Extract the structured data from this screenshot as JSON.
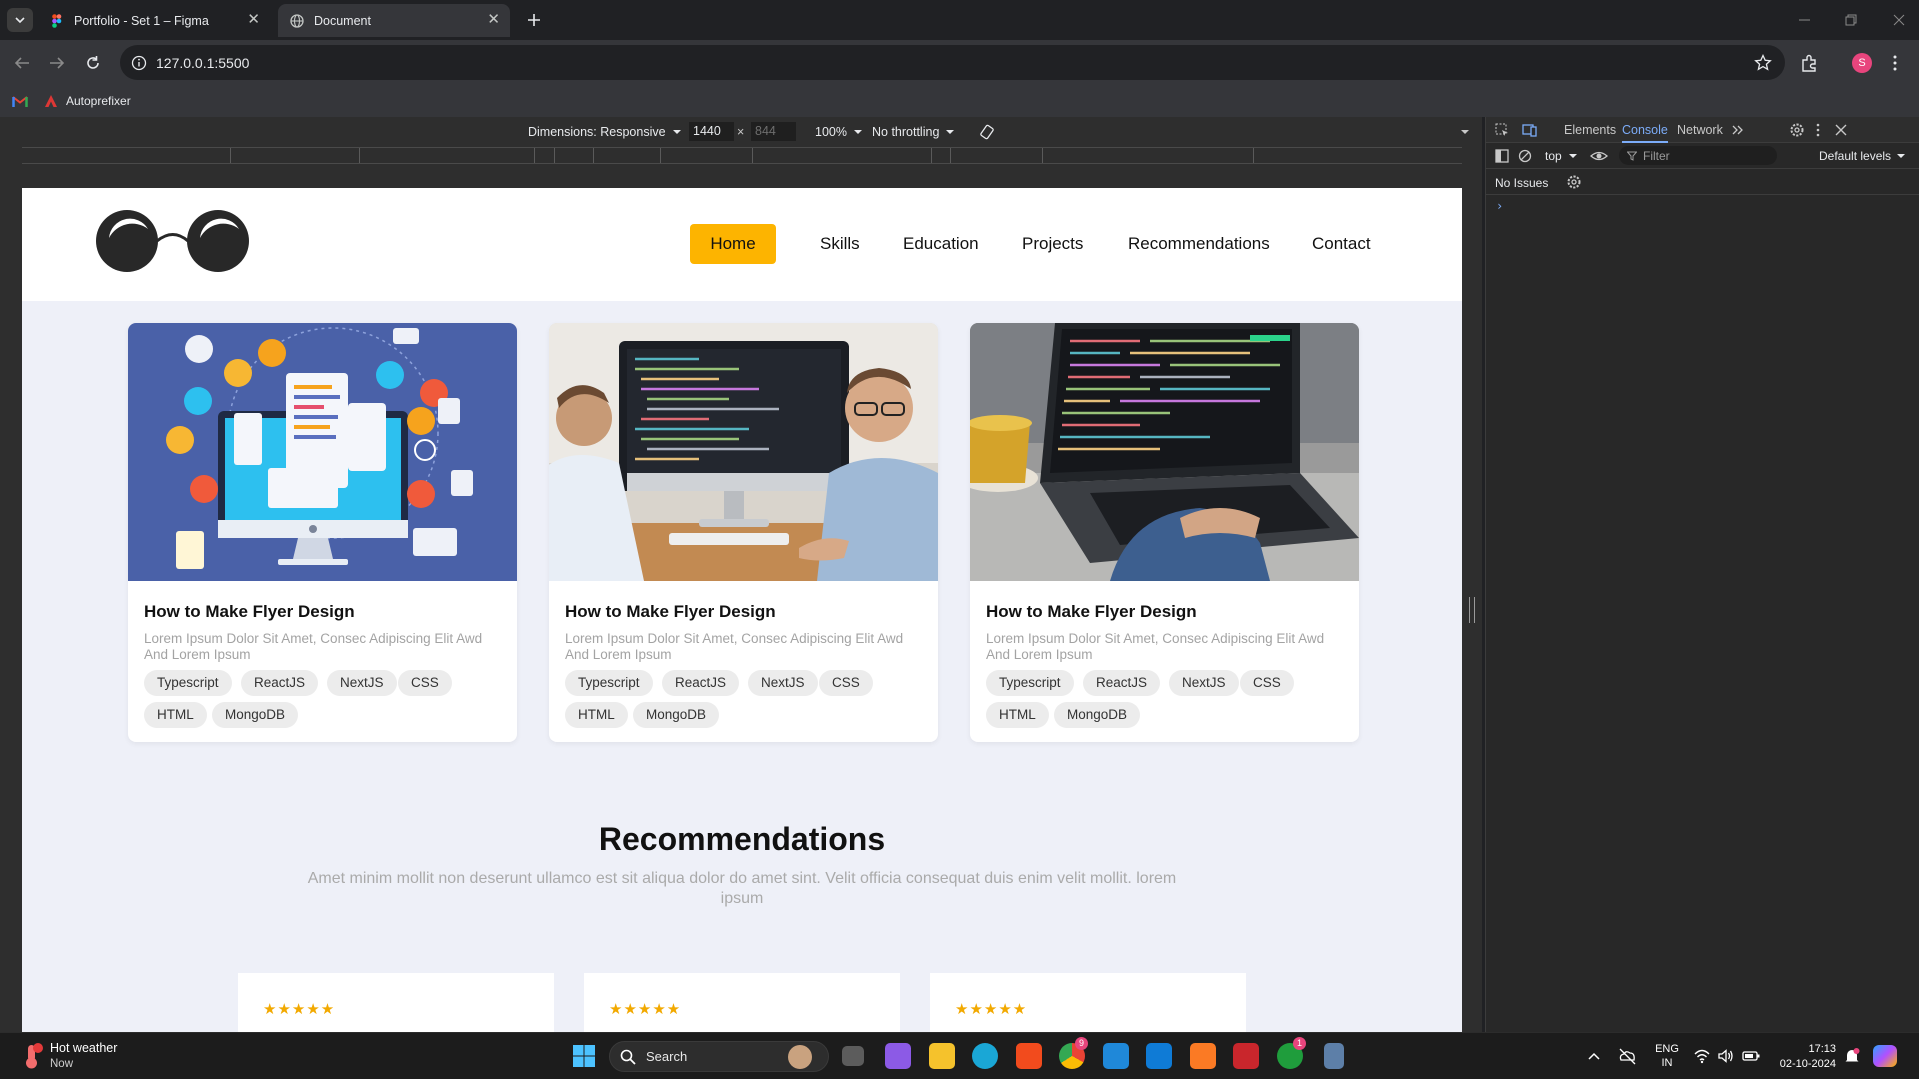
{
  "browser": {
    "tabs": [
      {
        "title": "Portfolio - Set 1 – Figma",
        "active": false
      },
      {
        "title": "Document",
        "active": true
      }
    ],
    "new_tab_icon": "plus-icon",
    "url": "127.0.0.1:5500",
    "profile_initial": "S",
    "bookmarks": [
      {
        "label": "",
        "icon": "gmail-icon"
      },
      {
        "label": "Autoprefixer",
        "icon": "autoprefixer-icon"
      }
    ]
  },
  "device_toolbar": {
    "dimensions_label": "Dimensions: Responsive",
    "width": "1440",
    "height_placeholder": "844",
    "times": "×",
    "zoom": "100%",
    "throttling": "No throttling"
  },
  "site": {
    "nav": {
      "items": [
        {
          "label": "Home",
          "active": true
        },
        {
          "label": "Skills",
          "active": false
        },
        {
          "label": "Education",
          "active": false
        },
        {
          "label": "Projects",
          "active": false
        },
        {
          "label": "Recommendations",
          "active": false
        },
        {
          "label": "Contact",
          "active": false
        }
      ],
      "accent": "#fdb400"
    },
    "projects": [
      {
        "title": "How to Make Flyer Design",
        "description": "Lorem Ipsum Dolor Sit Amet, Consec Adipiscing Elit Awd And Lorem Ipsum",
        "tags": [
          "Typescript",
          "ReactJS",
          "NextJS",
          "CSS",
          "HTML",
          "MongoDB"
        ],
        "image": "illustration-computer-icons"
      },
      {
        "title": "How to Make Flyer Design",
        "description": "Lorem Ipsum Dolor Sit Amet, Consec Adipiscing Elit Awd And Lorem Ipsum",
        "tags": [
          "Typescript",
          "ReactJS",
          "NextJS",
          "CSS",
          "HTML",
          "MongoDB"
        ],
        "image": "photo-two-developers-imac"
      },
      {
        "title": "How to Make Flyer Design",
        "description": "Lorem Ipsum Dolor Sit Amet, Consec Adipiscing Elit Awd And Lorem Ipsum",
        "tags": [
          "Typescript",
          "ReactJS",
          "NextJS",
          "CSS",
          "HTML",
          "MongoDB"
        ],
        "image": "photo-laptop-code"
      }
    ],
    "recommendations": {
      "title": "Recommendations",
      "subtitle": "Amet minim mollit non deserunt ullamco est sit aliqua dolor do amet sint. Velit officia consequat duis enim velit mollit. lorem ipsum",
      "cards": [
        {
          "stars": "★★★★★"
        },
        {
          "stars": "★★★★★"
        },
        {
          "stars": "★★★★★"
        }
      ]
    }
  },
  "devtools": {
    "tabs": [
      "Elements",
      "Console",
      "Network"
    ],
    "active_tab": "Console",
    "context": "top",
    "filter_placeholder": "Filter",
    "levels": "Default levels",
    "issues": "No Issues",
    "prompt": "›"
  },
  "taskbar": {
    "weather_title": "Hot weather",
    "weather_sub": "Now",
    "search_label": "Search",
    "lang_top": "ENG",
    "lang_bottom": "IN",
    "time": "17:13",
    "date": "02-10-2024",
    "chrome_badge": "9",
    "xbox_badge": "1"
  }
}
